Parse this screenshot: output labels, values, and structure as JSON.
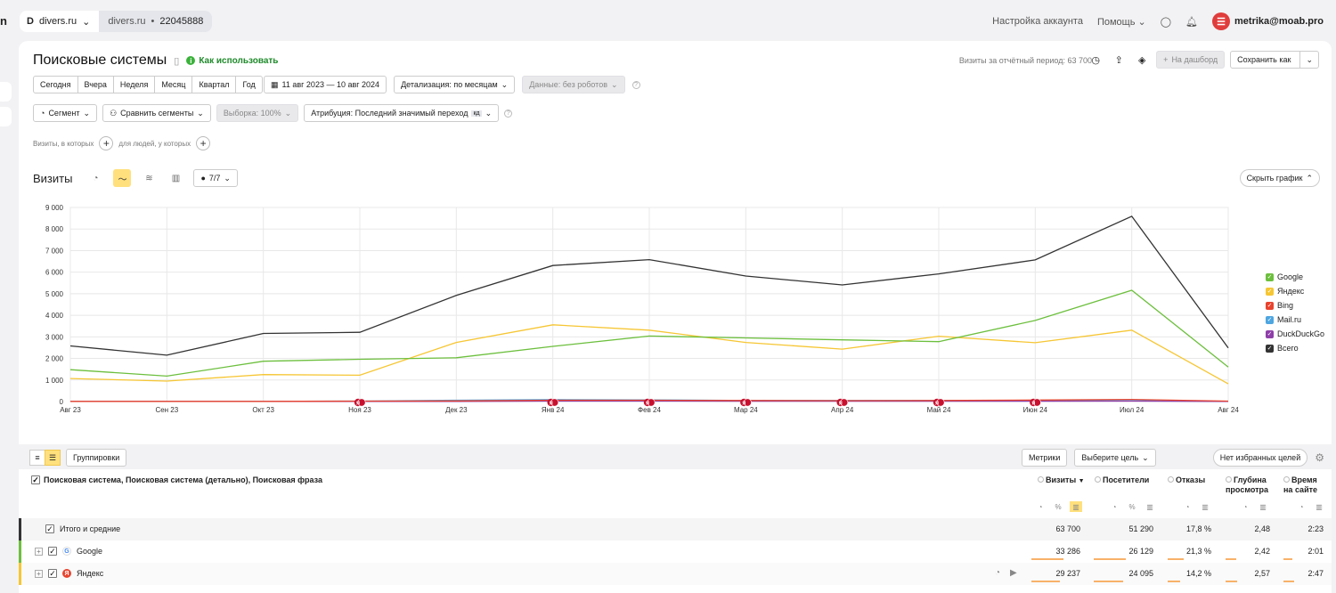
{
  "topbar": {
    "counter_site": "divers.ru",
    "counter_site_short": "divers.ru",
    "counter_id": "22045888",
    "account_settings": "Настройка аккаунта",
    "help": "Помощь",
    "user": "metrika@moab.pro"
  },
  "report": {
    "title": "Поисковые системы",
    "howto": "Как использовать",
    "visits_total": "Визиты за отчётный период: 63 700",
    "to_dashboard": "На дашборд",
    "save_as": "Сохранить как"
  },
  "period_buttons": [
    "Сегодня",
    "Вчера",
    "Неделя",
    "Месяц",
    "Квартал",
    "Год"
  ],
  "date_range": "11 авг 2023 — 10 авг 2024",
  "detail": "Детализация: по месяцам",
  "data_filter": "Данные: без роботов",
  "segment": "Сегмент",
  "compare": "Сравнить сегменты",
  "sample": "Выборка: 100%",
  "attribution": "Атрибуция: Последний значимый переход",
  "attribution_tag": "кд",
  "filter_visits": "Визиты, в которых",
  "filter_people": "для людей, у которых",
  "chart_head": {
    "title": "Визиты",
    "series_count": "7/7",
    "hide": "Скрыть график"
  },
  "colors": {
    "Google": "#6cbf3d",
    "Яндекс": "#f6c633",
    "Bing": "#e8432e",
    "Mail.ru": "#4ea6e0",
    "DuckDuckGo": "#8e3fa8",
    "Всего": "#333333"
  },
  "chart_data": {
    "type": "line",
    "categories": [
      "Авг 23",
      "Сен 23",
      "Окт 23",
      "Ноя 23",
      "Дек 23",
      "Янв 24",
      "Фев 24",
      "Мар 24",
      "Апр 24",
      "Май 24",
      "Июн 24",
      "Июл 24",
      "Авг 24"
    ],
    "y_ticks": [
      "0",
      "1 000",
      "2 000",
      "3 000",
      "4 000",
      "5 000",
      "6 000",
      "7 000",
      "8 000",
      "9 000"
    ],
    "ylim": [
      0,
      9000
    ],
    "legend_position": "right",
    "series": [
      {
        "name": "Google",
        "values": [
          1480,
          1180,
          1870,
          1960,
          2030,
          2560,
          3040,
          2950,
          2860,
          2780,
          3760,
          5160,
          1600
        ]
      },
      {
        "name": "Яндекс",
        "values": [
          1070,
          950,
          1250,
          1220,
          2740,
          3560,
          3310,
          2740,
          2430,
          3030,
          2730,
          3310,
          820
        ]
      },
      {
        "name": "Bing",
        "values": [
          10,
          10,
          10,
          20,
          30,
          60,
          60,
          50,
          40,
          50,
          70,
          100,
          20
        ]
      },
      {
        "name": "Mail.ru",
        "values": [
          10,
          10,
          10,
          20,
          60,
          90,
          80,
          50,
          50,
          50,
          40,
          40,
          10
        ]
      },
      {
        "name": "DuckDuckGo",
        "values": [
          5,
          5,
          5,
          5,
          10,
          20,
          20,
          15,
          15,
          15,
          15,
          20,
          5
        ]
      },
      {
        "name": "Всего",
        "values": [
          2580,
          2150,
          3160,
          3210,
          4920,
          6310,
          6580,
          5820,
          5410,
          5920,
          6570,
          8590,
          2490
        ]
      }
    ],
    "annotation_months": [
      3,
      5,
      6,
      7,
      8,
      9,
      10
    ],
    "annotation_label": "Я"
  },
  "table": {
    "groupings": "Группировки",
    "metrics": "Метрики",
    "goal": "Выберите цель",
    "favorites": "Нет избранных целей",
    "dimension": "Поисковая система, Поисковая система (детально), Поисковая фраза",
    "columns": [
      {
        "l1": "Визиты",
        "l2": ""
      },
      {
        "l1": "Посетители",
        "l2": ""
      },
      {
        "l1": "Отказы",
        "l2": ""
      },
      {
        "l1": "Глубина",
        "l2": "просмотра"
      },
      {
        "l1": "Время",
        "l2": "на сайте"
      }
    ],
    "rows": [
      {
        "label": "Итого и средние",
        "visits": "63 700",
        "visitors": "51 290",
        "bounce": "17,8 %",
        "depth": "2,48",
        "time": "2:23"
      },
      {
        "label": "Google",
        "visits": "33 286",
        "visitors": "26 129",
        "bounce": "21,3 %",
        "depth": "2,42",
        "time": "2:01"
      },
      {
        "label": "Яндекс",
        "visits": "29 237",
        "visitors": "24 095",
        "bounce": "14,2 %",
        "depth": "2,57",
        "time": "2:47"
      }
    ],
    "row_fill": [
      {
        "visits": 0.52,
        "visitors": 0.51
      },
      {
        "visits": 0.46,
        "visitors": 0.47
      }
    ]
  }
}
